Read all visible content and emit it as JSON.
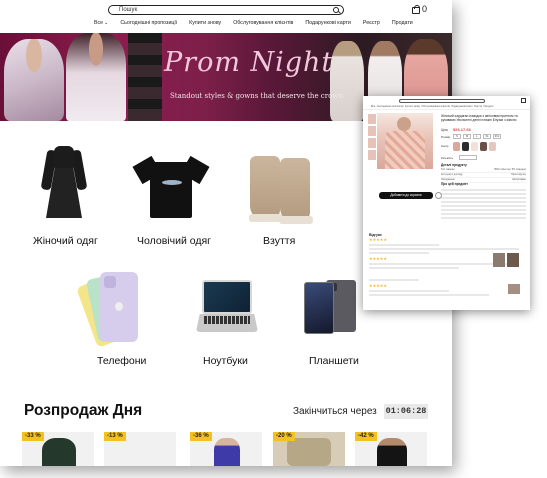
{
  "header": {
    "search_value": "Пошук",
    "cart_count": "0",
    "nav": [
      {
        "label": "Все",
        "has_chevron": true
      },
      {
        "label": "Сьогоднішні пропозиції"
      },
      {
        "label": "Купити знову"
      },
      {
        "label": "Обслуговування клієнтів"
      },
      {
        "label": "Подарункові карти"
      },
      {
        "label": "Реєстр"
      },
      {
        "label": "Продати"
      }
    ]
  },
  "banner": {
    "title": "Prom Night",
    "subtitle": "Standout styles & gowns that deserve the crown."
  },
  "categories": [
    {
      "label": "Жіночий одяг",
      "icon": "dress-image"
    },
    {
      "label": "Чоловічий одяг",
      "icon": "tshirt-image"
    },
    {
      "label": "Взуття",
      "icon": "boots-image"
    },
    {
      "label": "Телефони",
      "icon": "phones-image"
    },
    {
      "label": "Ноутбуки",
      "icon": "laptop-image"
    },
    {
      "label": "Планшети",
      "icon": "tablet-image"
    }
  ],
  "deals": {
    "title": "Розпродаж Дня",
    "timer_label": "Закінчиться через",
    "timer": "01:06:28",
    "products": [
      {
        "discount": "-33 %"
      },
      {
        "discount": "-13 %"
      },
      {
        "discount": "-36 %"
      },
      {
        "discount": "-20 %"
      },
      {
        "discount": "-42 %"
      }
    ]
  },
  "overlay": {
    "title": "Жіночий кардиган-накидка з квітковим принтом та рукавами Увольнені денні пляжні Блузки з кімоно",
    "price_label": "Ціна",
    "price": "$26.17.66",
    "size_label": "Розмір",
    "sizes": [
      "S",
      "M",
      "L",
      "XL",
      "2XL"
    ],
    "color_label": "Колір",
    "qty_label": "Кількість",
    "add_button": "Добавити до корзини",
    "details_title": "Деталі продукту",
    "details": [
      {
        "k": "Тип тканини",
        "v": "95% поліестер, 5% спандекс"
      },
      {
        "k": "Інструкції з догляду",
        "v": "Прати вручну"
      },
      {
        "k": "Походження",
        "v": "Імпортовано"
      }
    ],
    "about_title": "Про цей предмет",
    "reviews_title": "Відгуки",
    "colors": [
      "#d9a89a",
      "#2c2c2c",
      "#f1e1d8",
      "#6b5048",
      "#e7c6c0"
    ]
  }
}
